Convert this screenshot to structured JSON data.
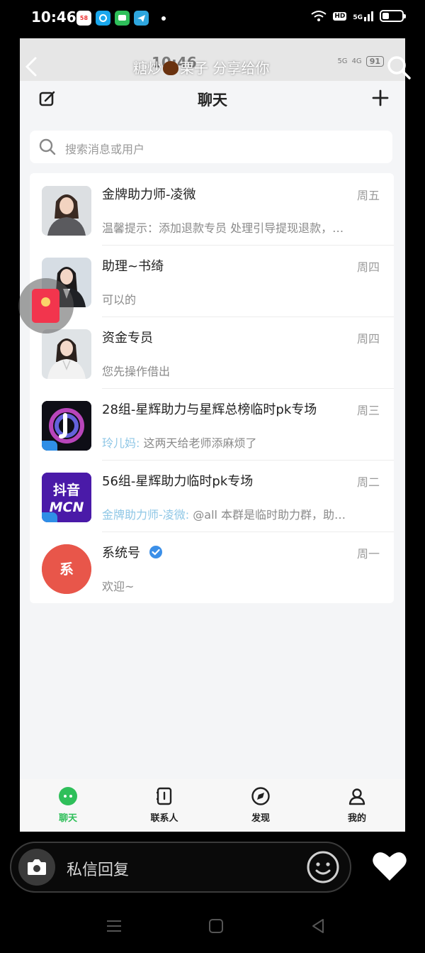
{
  "status_bar": {
    "time": "10:46",
    "app_badge": "58",
    "hd": "HD",
    "signal": "5G"
  },
  "inner_status": {
    "time": "10:46",
    "signal_5g": "5G",
    "signal_4g": "4G",
    "battery": "91"
  },
  "overlay": {
    "title_before": "糖炒",
    "title_after": "栗子 分享给你"
  },
  "header": {
    "title": "聊天"
  },
  "search": {
    "placeholder": "搜索消息或用户"
  },
  "chats": [
    {
      "name": "金牌助力师-凌微",
      "time": "周五",
      "message": "温馨提示：添加退款专员 处理引导提现退款，…",
      "sender": ""
    },
    {
      "name": "助理~书绮",
      "time": "周四",
      "message": "可以的",
      "sender": ""
    },
    {
      "name": "资金专员",
      "time": "周四",
      "message": "您先操作借出",
      "sender": ""
    },
    {
      "name": "28组-星辉助力与星辉总榜临时pk专场",
      "time": "周三",
      "message": "这两天给老师添麻烦了",
      "sender": "玲儿妈:"
    },
    {
      "name": "56组-星辉助力临时pk专场",
      "time": "周二",
      "message": "@all 本群是临时助力群，助…",
      "sender": "金牌助力师-凌微:"
    },
    {
      "name": "系统号",
      "time": "周一",
      "message": "欢迎~",
      "sender": ""
    }
  ],
  "avatars": {
    "douyin_line1": "抖音",
    "douyin_line2": "MCN",
    "system": "系"
  },
  "tabs": [
    {
      "label": "聊天",
      "icon": "chat-bubble-icon",
      "active": true
    },
    {
      "label": "联系人",
      "icon": "contacts-book-icon",
      "active": false
    },
    {
      "label": "发现",
      "icon": "compass-icon",
      "active": false
    },
    {
      "label": "我的",
      "icon": "person-icon",
      "active": false
    }
  ],
  "reply": {
    "placeholder": "私信回复"
  },
  "colors": {
    "accent_green": "#2fbf5a",
    "red_packet": "#f2354d",
    "system_avatar": "#e8564a",
    "sender_blue": "#8fc7e6",
    "verified_blue": "#3b8fe8"
  }
}
